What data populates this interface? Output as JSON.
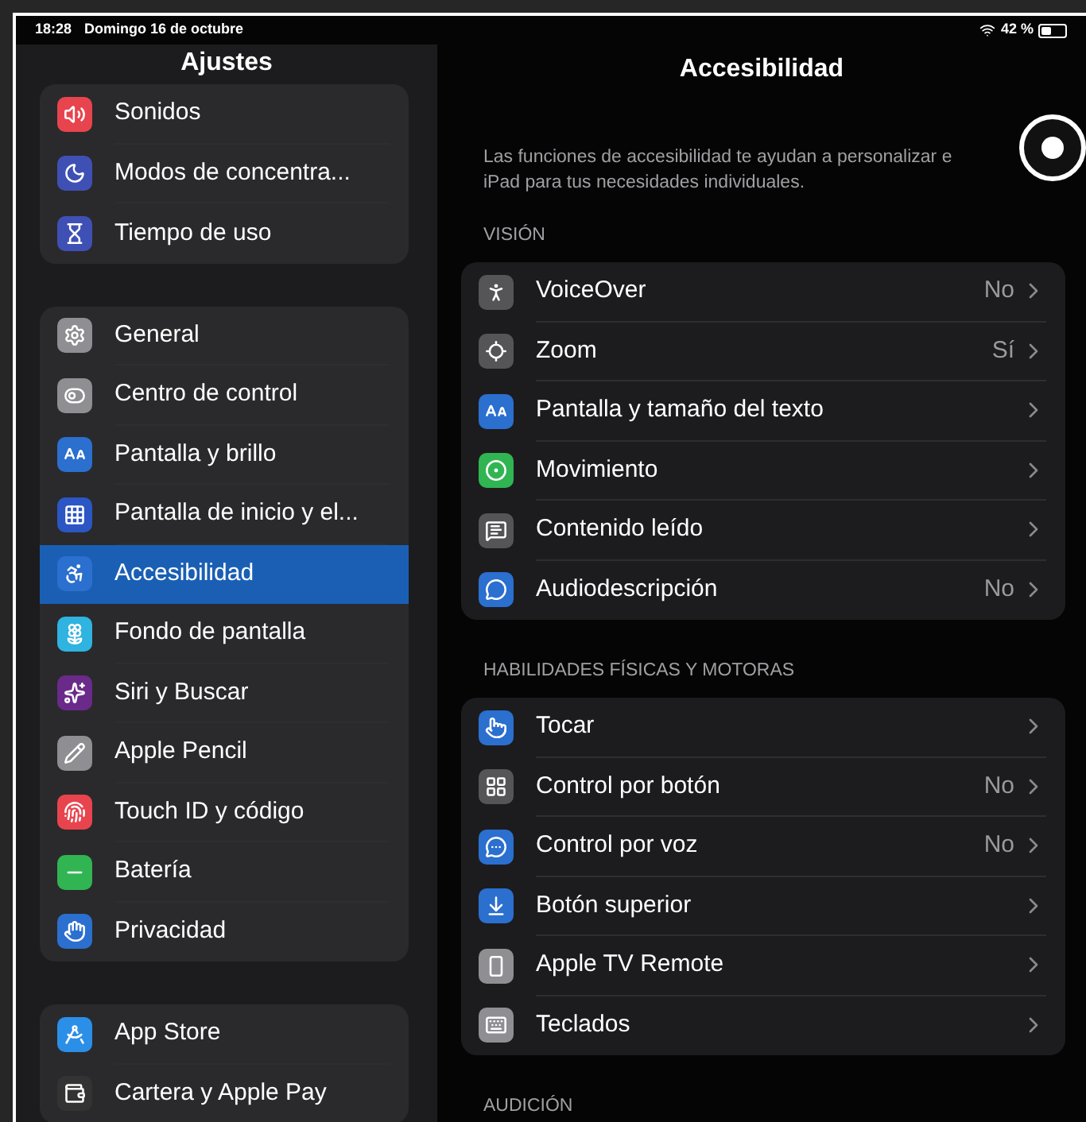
{
  "status_bar": {
    "time": "18:28",
    "date": "Domingo 16 de octubre",
    "battery": "42 %"
  },
  "sidebar": {
    "title": "Ajustes",
    "groups": [
      [
        {
          "label": "Sonidos",
          "color": "#e8444e",
          "selected": false
        },
        {
          "label": "Modos de concentra...",
          "color": "#3f50b5",
          "selected": false
        },
        {
          "label": "Tiempo de uso",
          "color": "#3f50b5",
          "selected": false
        }
      ],
      [
        {
          "label": "General",
          "color": "#8e8e93",
          "selected": false
        },
        {
          "label": "Centro de control",
          "color": "#8e8e93",
          "selected": false
        },
        {
          "label": "Pantalla y brillo",
          "color": "#2b6fcf",
          "selected": false
        },
        {
          "label": "Pantalla de inicio y el...",
          "color": "#2b56c4",
          "selected": false
        },
        {
          "label": "Accesibilidad",
          "color": "#2b6fcf",
          "selected": true
        },
        {
          "label": "Fondo de pantalla",
          "color": "#2fb3e0",
          "selected": false
        },
        {
          "label": "Siri y Buscar",
          "color": "#6a2a8a",
          "selected": false
        },
        {
          "label": "Apple Pencil",
          "color": "#8e8e93",
          "selected": false
        },
        {
          "label": "Touch ID y código",
          "color": "#e8444e",
          "selected": false
        },
        {
          "label": "Batería",
          "color": "#30b552",
          "selected": false
        },
        {
          "label": "Privacidad",
          "color": "#2b6fcf",
          "selected": false
        }
      ],
      [
        {
          "label": "App Store",
          "color": "#2b8fe8",
          "selected": false
        },
        {
          "label": "Cartera y Apple Pay",
          "color": "#333333",
          "selected": false
        }
      ]
    ]
  },
  "detail": {
    "title": "Accesibilidad",
    "description": [
      "Las funciones de accesibilidad te ayudan a personalizar e",
      "iPad para tus necesidades individuales."
    ],
    "sections": [
      {
        "header": "VISIÓN",
        "items": [
          {
            "label": "VoiceOver",
            "value": "No",
            "color": "#555558"
          },
          {
            "label": "Zoom",
            "value": "Sí",
            "color": "#555558"
          },
          {
            "label": "Pantalla y tamaño del texto",
            "color": "#2b6fcf"
          },
          {
            "label": "Movimiento",
            "color": "#30b552"
          },
          {
            "label": "Contenido leído",
            "color": "#555558"
          },
          {
            "label": "Audiodescripción",
            "value": "No",
            "color": "#2b6fcf"
          }
        ]
      },
      {
        "header": "HABILIDADES FÍSICAS Y MOTORAS",
        "items": [
          {
            "label": "Tocar",
            "color": "#2b6fcf"
          },
          {
            "label": "Control por botón",
            "value": "No",
            "color": "#555558"
          },
          {
            "label": "Control por voz",
            "value": "No",
            "color": "#2b6fcf"
          },
          {
            "label": "Botón superior",
            "color": "#2b6fcf"
          },
          {
            "label": "Apple TV Remote",
            "color": "#8e8e93"
          },
          {
            "label": "Teclados",
            "color": "#8e8e93"
          }
        ]
      },
      {
        "header": "AUDICIÓN"
      }
    ]
  }
}
